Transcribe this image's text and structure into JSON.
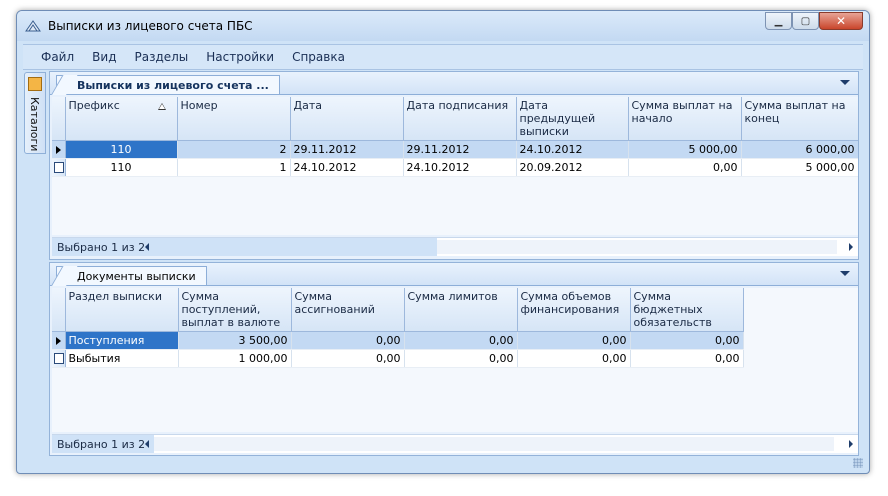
{
  "window": {
    "title": "Выписки из лицевого счета ПБС",
    "icon": "app-logo-icon",
    "buttons": {
      "minimize": "▁",
      "maximize": "▢",
      "close": "✕"
    }
  },
  "menu": [
    "Файл",
    "Вид",
    "Разделы",
    "Настройки",
    "Справка"
  ],
  "sidebar": {
    "tab_label": "Каталоги"
  },
  "top_panel": {
    "tab_label": "Выписки из лицевого счета ...",
    "columns": [
      "Префикс",
      "Номер",
      "Дата",
      "Дата подписания",
      "Дата предыдущей выписки",
      "Сумма выплат на начало",
      "Сумма выплат на конец"
    ],
    "rows": [
      [
        "110",
        "2",
        "29.11.2012",
        "29.11.2012",
        "24.10.2012",
        "5 000,00",
        "6 000,00"
      ],
      [
        "110",
        "1",
        "24.10.2012",
        "24.10.2012",
        "20.09.2012",
        "0,00",
        "5 000,00"
      ]
    ],
    "status": "Выбрано 1 из 2"
  },
  "bottom_panel": {
    "tab_label": "Документы выписки",
    "columns": [
      "Раздел выписки",
      "Сумма поступлений, выплат в валюте",
      "Сумма ассигнований",
      "Сумма лимитов",
      "Сумма объемов финансирования",
      "Сумма бюджетных обязательств"
    ],
    "rows": [
      [
        "Поступления",
        "3 500,00",
        "0,00",
        "0,00",
        "0,00",
        "0,00"
      ],
      [
        "Выбытия",
        "1 000,00",
        "0,00",
        "0,00",
        "0,00",
        "0,00"
      ]
    ],
    "status": "Выбрано 1 из 2"
  }
}
